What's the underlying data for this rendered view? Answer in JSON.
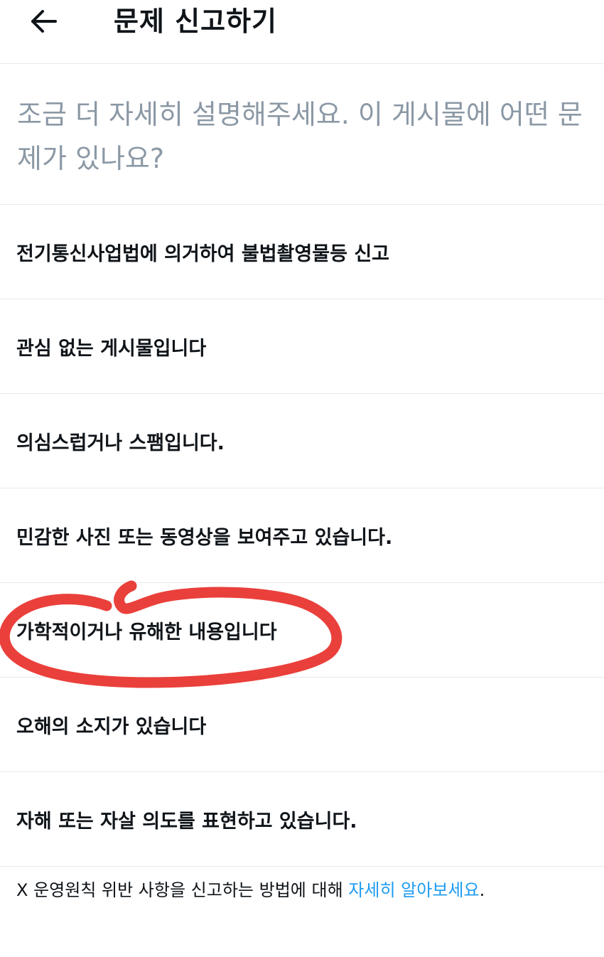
{
  "header": {
    "title": "문제 신고하기",
    "back_icon": "arrow-left-icon"
  },
  "prompt": {
    "text": "조금 더 자세히 설명해주세요. 이 게시물에 어떤 문제가 있나요?"
  },
  "options": [
    {
      "label": "전기통신사업법에 의거하여 불법촬영물등 신고"
    },
    {
      "label": "관심 없는 게시물입니다"
    },
    {
      "label": "의심스럽거나 스팸입니다."
    },
    {
      "label": "민감한 사진 또는 동영상을 보여주고 있습니다."
    },
    {
      "label": "가학적이거나 유해한 내용입니다"
    },
    {
      "label": "오해의 소지가 있습니다"
    },
    {
      "label": "자해 또는 자살 의도를 표현하고 있습니다."
    }
  ],
  "footer": {
    "text": "X 운영원칙 위반 사항을 신고하는 방법에 대해 ",
    "link": "자세히 알아보세요",
    "suffix": "."
  },
  "colors": {
    "prompt_text": "#8b98a5",
    "divider": "#e6eaec",
    "link": "#1d9bf0",
    "annotation": "#e8302a"
  }
}
